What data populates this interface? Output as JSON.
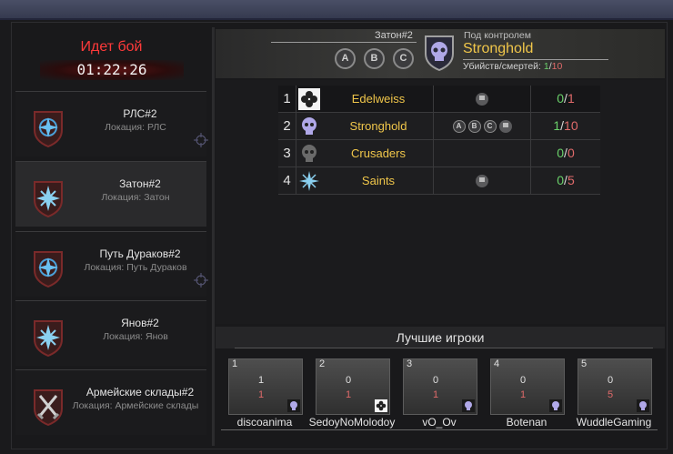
{
  "battle": {
    "status": "Идет бой",
    "timer": "01:22:26"
  },
  "locations": [
    {
      "name": "РЛС#2",
      "sub": "Локация: РЛС",
      "icon": "shield-compass-icon",
      "active": false
    },
    {
      "name": "Затон#2",
      "sub": "Локация: Затон",
      "icon": "shield-star-icon",
      "active": true
    },
    {
      "name": "Путь Дураков#2",
      "sub": "Локация: Путь Дураков",
      "icon": "shield-compass-icon",
      "active": false
    },
    {
      "name": "Янов#2",
      "sub": "Локация: Янов",
      "icon": "shield-star-icon",
      "active": false
    },
    {
      "name": "Армейские склады#2",
      "sub": "Локация: Армейские склады",
      "icon": "shield-swords-icon",
      "active": false
    }
  ],
  "header": {
    "location": "Затон#2",
    "points": [
      "A",
      "B",
      "C"
    ],
    "control_label": "Под контролем",
    "control_team": "Stronghold",
    "kd_label": "Убийств/смертей:",
    "kd_kills": "1",
    "kd_sep": "/",
    "kd_deaths": "10"
  },
  "teams": [
    {
      "rank": "1",
      "name": "Edelweiss",
      "icon": "clover-icon",
      "caps": [
        "flag"
      ],
      "kills": "0",
      "deaths": "1"
    },
    {
      "rank": "2",
      "name": "Stronghold",
      "icon": "skull-icon",
      "caps": [
        "A",
        "B",
        "C",
        "flag"
      ],
      "kills": "1",
      "deaths": "10"
    },
    {
      "rank": "3",
      "name": "Crusaders",
      "icon": "skull-gray-icon",
      "caps": [],
      "kills": "0",
      "deaths": "0"
    },
    {
      "rank": "4",
      "name": "Saints",
      "icon": "star-icon",
      "caps": [
        "flag"
      ],
      "kills": "0",
      "deaths": "5"
    }
  ],
  "best_title": "Лучшие игроки",
  "players": [
    {
      "rank": "1",
      "kills": "1",
      "deaths": "1",
      "name": "discoanima"
    },
    {
      "rank": "2",
      "kills": "0",
      "deaths": "1",
      "name": "SedoyNoMolodoy"
    },
    {
      "rank": "3",
      "kills": "0",
      "deaths": "1",
      "name": "vO_Ov"
    },
    {
      "rank": "4",
      "kills": "0",
      "deaths": "1",
      "name": "Botenan"
    },
    {
      "rank": "5",
      "kills": "0",
      "deaths": "5",
      "name": "WuddleGaming"
    }
  ],
  "colors": {
    "team": "#f0c64a",
    "battle": "#ff3a3a",
    "kills": "#6ad06a",
    "deaths": "#e06a6a"
  }
}
